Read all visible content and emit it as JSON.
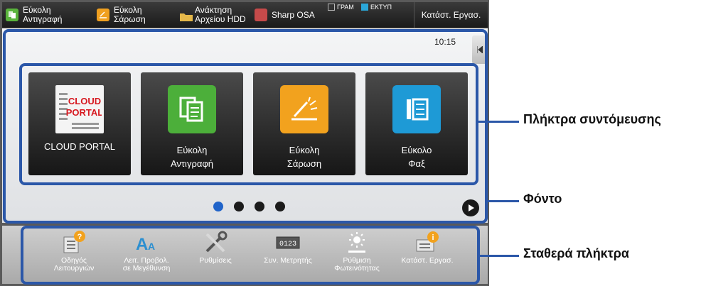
{
  "topbar": {
    "items": [
      {
        "label_line1": "Εύκολη",
        "label_line2": "Αντιγραφή",
        "icon": "easy-copy-icon",
        "color": "#5ab43c"
      },
      {
        "label_line1": "Εύκολη",
        "label_line2": "Σάρωση",
        "icon": "easy-scan-icon",
        "color": "#f0a020"
      },
      {
        "label_line1": "Ανάκτηση",
        "label_line2": "Αρχείου HDD",
        "icon": "folder-icon",
        "color": "#e5b84a"
      },
      {
        "label_line1": "Sharp OSA",
        "label_line2": "",
        "icon": "sharp-osa-icon",
        "color": "#c64a4a"
      }
    ],
    "indicators": [
      {
        "label": "ΓΡΑΜ",
        "color": "#333333"
      },
      {
        "label": "ΕΚΤΥΠ",
        "color": "#2aa6d8"
      }
    ],
    "status_button": "Κατάστ. Εργασ."
  },
  "main": {
    "time": "10:15",
    "tiles": [
      {
        "line1": "CLOUD PORTAL",
        "line2": "",
        "icon": "cloud-portal-icon"
      },
      {
        "line1": "Εύκολη",
        "line2": "Αντιγραφή",
        "icon": "easy-copy-icon",
        "color": "#4caf3a"
      },
      {
        "line1": "Εύκολη",
        "line2": "Σάρωση",
        "icon": "easy-scan-icon",
        "color": "#f2a21e"
      },
      {
        "line1": "Εύκολο",
        "line2": "Φαξ",
        "icon": "easy-fax-icon",
        "color": "#1e9ad6"
      }
    ],
    "cloud_portal_logo": [
      "CLOUD",
      "PORTAL"
    ],
    "pages": 4,
    "active_page": 1
  },
  "fixed_keys": [
    {
      "line1": "Οδηγός",
      "line2": "Λειτουργιών",
      "icon": "guide-icon"
    },
    {
      "line1": "Λειτ. Προβολ.",
      "line2": "σε Μεγέθυνση",
      "icon": "magnify-display-icon"
    },
    {
      "line1": "Ρυθμίσεις",
      "line2": "",
      "icon": "settings-tools-icon"
    },
    {
      "line1": "Συν. Μετρητής",
      "line2": "",
      "icon": "counter-icon"
    },
    {
      "line1": "Ρύθμιση",
      "line2": "Φωτεινότητας",
      "icon": "brightness-icon"
    },
    {
      "line1": "Κατάστ. Εργασ.",
      "line2": "",
      "icon": "job-status-icon"
    }
  ],
  "counter_digits": "0123",
  "callouts": {
    "shortcut_keys": "Πλήκτρα συντόμευσης",
    "background": "Φόντο",
    "fixed_keys": "Σταθερά πλήκτρα"
  },
  "colors": {
    "highlight": "#2b57a8",
    "active_dot": "#1f63c9"
  }
}
